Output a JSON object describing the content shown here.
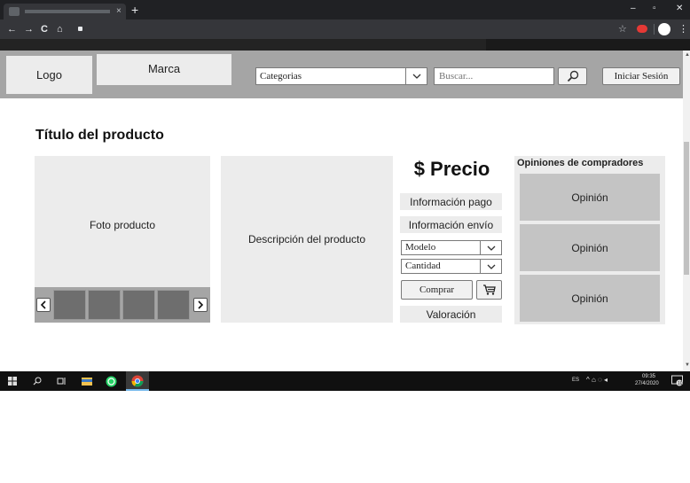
{
  "browser": {
    "tab_close_glyph": "×",
    "new_tab_glyph": "+",
    "window_controls": [
      "–",
      "▫",
      "✕"
    ],
    "nav_glyphs": [
      "←",
      "→",
      "C",
      "⌂"
    ],
    "ext_star_glyph": "☆",
    "menu_glyph": "⋮"
  },
  "header": {
    "logo": "Logo",
    "brand": "Marca",
    "category_select": "Categorias",
    "search_placeholder": "Buscar...",
    "login": "Iniciar Sesión"
  },
  "product": {
    "title": "Título del producto",
    "photo_label": "Foto producto",
    "prev_arrow": "<",
    "next_arrow": ">",
    "description": "Descripción del producto",
    "price": "$ Precio",
    "payment_info": "Información pago",
    "shipping_info": "Información envío",
    "model_select": "Modelo",
    "quantity_select": "Cantidad",
    "buy": "Comprar",
    "rating": "Valoración"
  },
  "opinions": {
    "heading": "Opiniones de compradores",
    "items": [
      "Opinión",
      "Opinión",
      "Opinión"
    ]
  },
  "taskbar": {
    "lang": "ES",
    "tray_icons": "^ ⌂ ◌ ◂",
    "time": "09:35",
    "date": "27/4/2020",
    "notifications": "10"
  },
  "colors": {
    "header_bg": "#a5a5a5",
    "box_bg": "#ececec",
    "opinion_bg": "#c4c4c4",
    "chrome_dark": "#202124",
    "taskbar": "#101010"
  },
  "icons": [
    "search-icon",
    "cart-icon",
    "chevron-down-icon",
    "chevron-left-icon",
    "chevron-right-icon",
    "windows-start-icon",
    "whatsapp-icon",
    "chrome-icon",
    "folder-icon"
  ]
}
